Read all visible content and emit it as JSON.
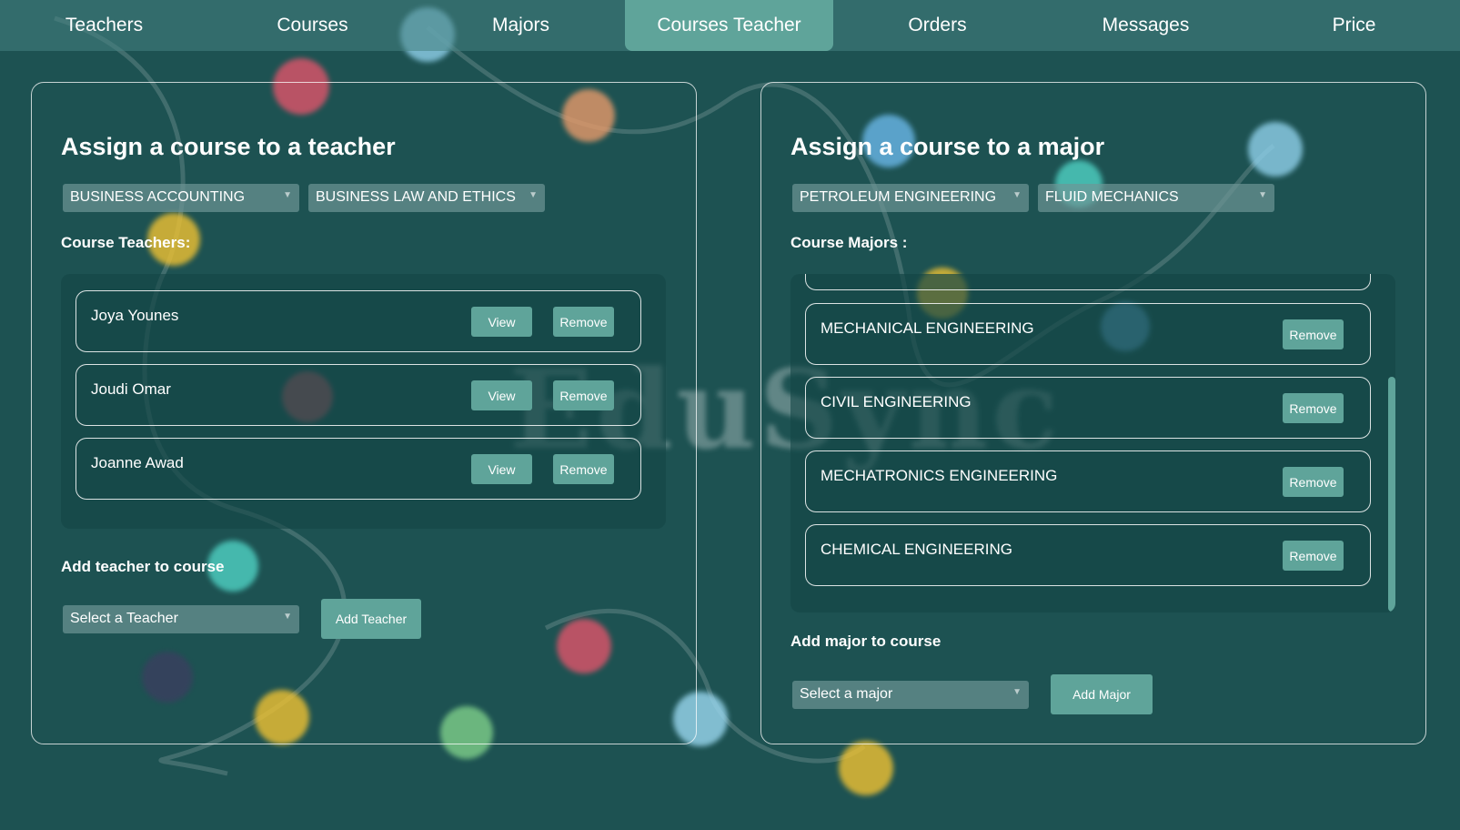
{
  "nav": {
    "items": [
      "Teachers",
      "Courses",
      "Majors",
      "Courses Teacher",
      "Orders",
      "Messages",
      "Price"
    ],
    "active_index": 3
  },
  "background": {
    "watermark": "EduSync"
  },
  "left_panel": {
    "title": "Assign a course to a teacher",
    "select_major": "BUSINESS ACCOUNTING",
    "select_course": "BUSINESS LAW AND ETHICS",
    "list_label": "Course Teachers:",
    "teachers": [
      "Joya Younes",
      "Joudi Omar",
      "Joanne Awad"
    ],
    "view_label": "View",
    "remove_label": "Remove",
    "add_label": "Add teacher to course",
    "select_placeholder": "Select a Teacher",
    "add_button": "Add Teacher"
  },
  "right_panel": {
    "title": "Assign a course to a major",
    "select_major": "PETROLEUM ENGINEERING",
    "select_course": "FLUID MECHANICS",
    "list_label": "Course Majors :",
    "majors": [
      "MECHANICAL ENGINEERING",
      "CIVIL ENGINEERING",
      "MECHATRONICS ENGINEERING",
      "CHEMICAL ENGINEERING"
    ],
    "remove_label": "Remove",
    "add_label": "Add major to course",
    "select_placeholder": "Select a major",
    "add_button": "Add Major"
  },
  "colors": {
    "background": "#1d5252",
    "accent": "#5fa49a"
  }
}
